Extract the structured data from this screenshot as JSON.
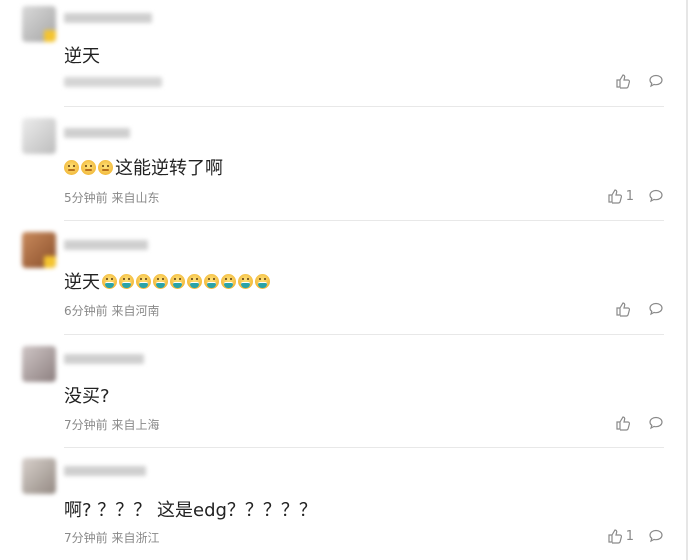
{
  "comments": [
    {
      "text": "逆天",
      "time": "",
      "location": "",
      "likes": ""
    },
    {
      "text": "这能逆转了啊",
      "time": "5分钟前",
      "location": "来自山东",
      "likes": "1"
    },
    {
      "text": "逆天",
      "time": "6分钟前",
      "location": "来自河南",
      "likes": ""
    },
    {
      "text": "没买?",
      "time": "7分钟前",
      "location": "来自上海",
      "likes": ""
    },
    {
      "text": "啊? ？？？ 这是edg？？？？？",
      "time": "7分钟前",
      "location": "来自浙江",
      "likes": "1"
    }
  ],
  "icons": {
    "like": "thumbs-up-icon",
    "reply": "comment-bubble-icon",
    "emoji_think": "thinking-emoji",
    "emoji_grin": "grimace-emoji"
  },
  "colors": {
    "meta": "#8a8a8a",
    "divider": "#e8e8e8"
  }
}
